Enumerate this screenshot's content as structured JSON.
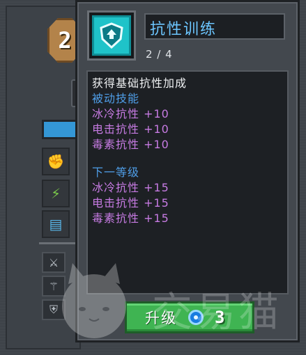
{
  "background": {
    "level_number": "2",
    "slot_icons": [
      "fist-icon",
      "leaf-icon",
      "book-icon"
    ],
    "equipment_icons": [
      "sword-icon",
      "wand-icon",
      "shield-icon"
    ]
  },
  "tooltip": {
    "skill_name": "抗性训练",
    "skill_icon": "shield-icon",
    "progress": "2 / 4",
    "description": "获得基础抗性加成",
    "passive_header": "被动技能",
    "current_effects": [
      "冰冷抗性 +10",
      "电击抗性 +10",
      "毒素抗性 +10"
    ],
    "next_level_header": "下一等级",
    "next_effects": [
      "冰冷抗性 +15",
      "电击抗性 +15",
      "毒素抗性 +15"
    ],
    "upgrade_label": "升级",
    "currency_icon": "gem-icon",
    "upgrade_cost": "3"
  },
  "watermark": {
    "text": "交易猫"
  },
  "colors": {
    "title": "#6cc6ff",
    "section_header": "#4f9ee8",
    "effect": "#c77be3",
    "button": "#3fb452"
  }
}
